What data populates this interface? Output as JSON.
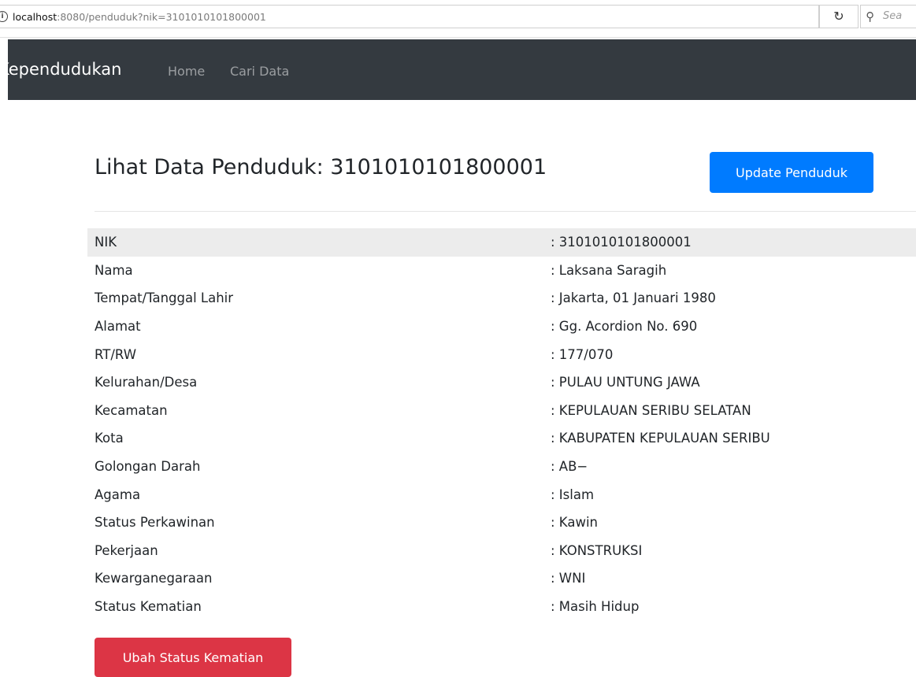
{
  "browser": {
    "url_host": "localhost",
    "url_rest": ":8080/penduduk?nik=3101010101800001",
    "search_placeholder": "Sea"
  },
  "navbar": {
    "brand": "Kependudukan",
    "links": [
      "Home",
      "Cari Data"
    ]
  },
  "page": {
    "title": "Lihat Data Penduduk: 3101010101800001",
    "update_button": "Update Penduduk",
    "death_status_button": "Ubah Status Kematian"
  },
  "rows": [
    {
      "label": "NIK",
      "value": ": 3101010101800001"
    },
    {
      "label": "Nama",
      "value": ": Laksana Saragih"
    },
    {
      "label": "Tempat/Tanggal Lahir",
      "value": ": Jakarta, 01 Januari 1980"
    },
    {
      "label": "Alamat",
      "value": ": Gg. Acordion No. 690"
    },
    {
      "label": "RT/RW",
      "value": ": 177/070"
    },
    {
      "label": "Kelurahan/Desa",
      "value": ": PULAU UNTUNG JAWA"
    },
    {
      "label": "Kecamatan",
      "value": ": KEPULAUAN SERIBU SELATAN"
    },
    {
      "label": "Kota",
      "value": ": KABUPATEN KEPULAUAN SERIBU"
    },
    {
      "label": "Golongan Darah",
      "value": ": AB−"
    },
    {
      "label": "Agama",
      "value": ": Islam"
    },
    {
      "label": "Status Perkawinan",
      "value": ": Kawin"
    },
    {
      "label": "Pekerjaan",
      "value": ": KONSTRUKSI"
    },
    {
      "label": "Kewarganegaraan",
      "value": ": WNI"
    },
    {
      "label": "Status Kematian",
      "value": ": Masih Hidup"
    }
  ]
}
